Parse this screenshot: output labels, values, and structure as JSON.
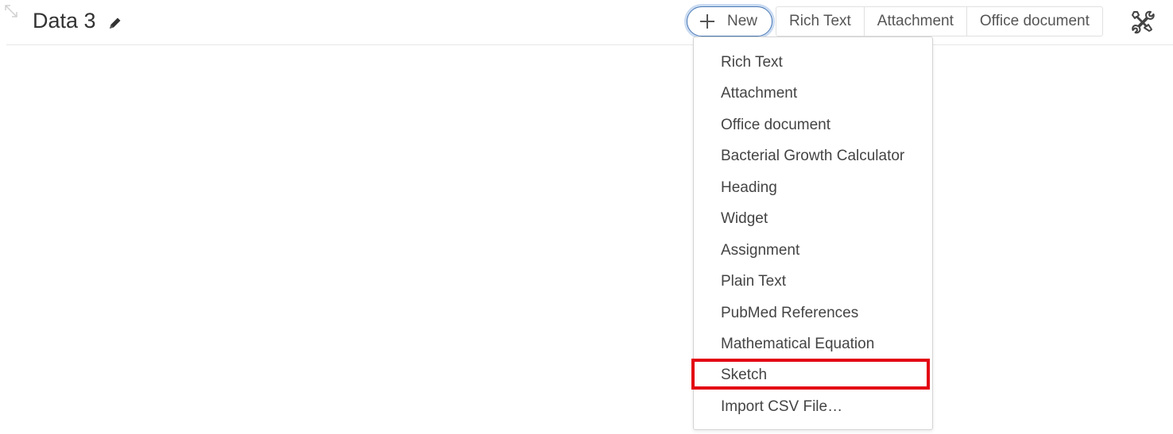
{
  "header": {
    "title": "Data 3",
    "icons": {
      "resize": "resize-diagonal-icon",
      "edit": "pencil-icon",
      "new": "plus-icon",
      "tools": "tools-icon"
    }
  },
  "toolbar": {
    "new_label": "New",
    "quick_buttons": [
      "Rich Text",
      "Attachment",
      "Office document"
    ]
  },
  "dropdown": {
    "items": [
      "Rich Text",
      "Attachment",
      "Office document",
      "Bacterial Growth Calculator",
      "Heading",
      "Widget",
      "Assignment",
      "Plain Text",
      "PubMed References",
      "Mathematical Equation",
      "Sketch",
      "Import CSV File…"
    ],
    "highlighted_item": "Sketch",
    "highlight_color": "#e30613"
  },
  "colors": {
    "new_button_border": "#4a78b5",
    "text": "#444444"
  }
}
